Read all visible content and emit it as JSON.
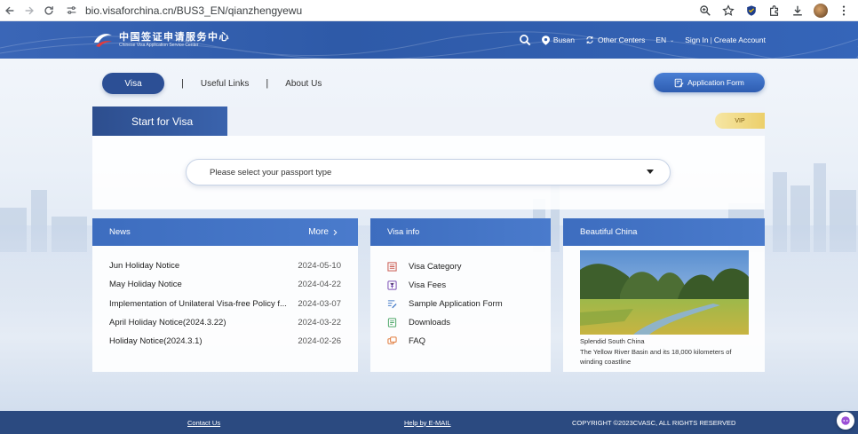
{
  "browser": {
    "url": "bio.visaforchina.cn/BUS3_EN/qianzhengyewu"
  },
  "header": {
    "logo_cn": "中国签证申请服务中心",
    "logo_en": "Chinese Visa Application Service Center",
    "location": "Busan",
    "other_centers": "Other Centers",
    "language": "EN",
    "sign_in": "Sign In",
    "separator": "|",
    "create_account": "Create Account"
  },
  "nav": {
    "visa": "Visa",
    "separator": "|",
    "useful_links": "Useful Links",
    "about_us": "About Us",
    "application_form": "Application Form"
  },
  "start": {
    "title": "Start for Visa",
    "vip": "VIP",
    "select_placeholder": "Please select your passport type"
  },
  "news": {
    "title": "News",
    "more": "More",
    "items": [
      {
        "title": "Jun Holiday Notice",
        "date": "2024-05-10"
      },
      {
        "title": "May Holiday Notice",
        "date": "2024-04-22"
      },
      {
        "title": "Implementation of Unilateral Visa-free Policy f...",
        "date": "2024-03-07"
      },
      {
        "title": "April Holiday Notice(2024.3.22)",
        "date": "2024-03-22"
      },
      {
        "title": "Holiday Notice(2024.3.1)",
        "date": "2024-02-26"
      }
    ]
  },
  "visa_info": {
    "title": "Visa info",
    "items": [
      {
        "label": "Visa Category",
        "icon": "list-icon",
        "color": "#c9584f"
      },
      {
        "label": "Visa Fees",
        "icon": "fee-icon",
        "color": "#7b4fb5"
      },
      {
        "label": "Sample Application Form",
        "icon": "form-icon",
        "color": "#4a7fc9"
      },
      {
        "label": "Downloads",
        "icon": "download-icon",
        "color": "#4fa86a"
      },
      {
        "label": "FAQ",
        "icon": "faq-icon",
        "color": "#e07a3a"
      }
    ]
  },
  "beautiful_china": {
    "title": "Beautiful China",
    "caption_title": "Splendid South China",
    "caption_text": "The Yellow River Basin and its 18,000 kilometers of winding coastline"
  },
  "footer": {
    "contact": "Contact Us",
    "help": "Help by E-MAIL",
    "copyright": "COPYRIGHT ©2023CVASC, ALL RIGHTS RESERVED"
  },
  "colors": {
    "header_blue": "#3565b9",
    "nav_pill": "#2c4f95",
    "card_head": "#4a7bcc",
    "footer": "#2b4a80",
    "vip_gold": "#eccf6a"
  }
}
